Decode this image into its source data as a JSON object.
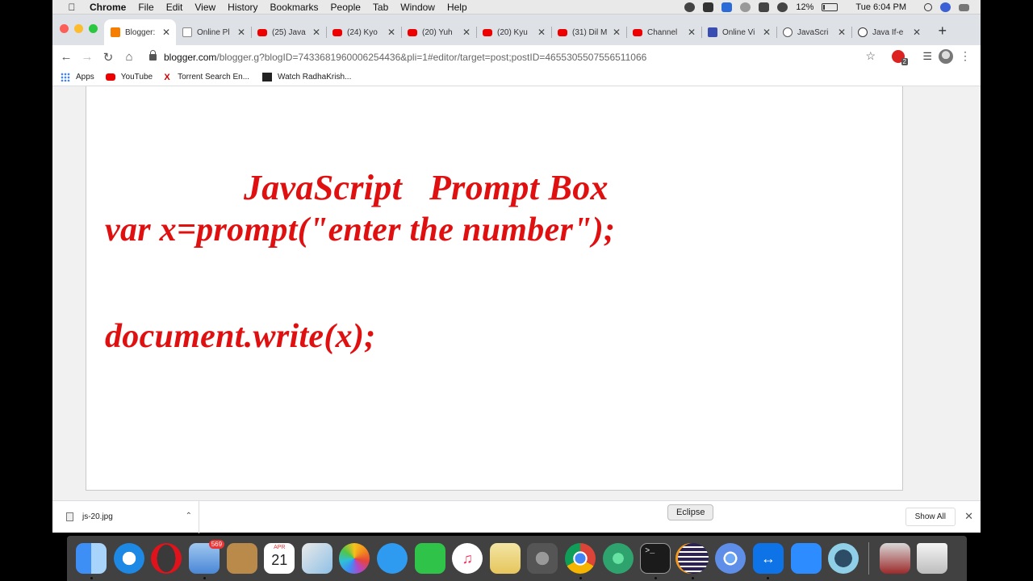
{
  "menubar": {
    "app_name": "Chrome",
    "items": [
      "File",
      "Edit",
      "View",
      "History",
      "Bookmarks",
      "People",
      "Tab",
      "Window",
      "Help"
    ],
    "battery": "12%",
    "battery_level": 0.12,
    "clock": "Tue 6:04 PM"
  },
  "browser": {
    "tabs": [
      {
        "title": "Blogger:",
        "favicon": "blogger-icon",
        "active": true
      },
      {
        "title": "Online Pl",
        "favicon": "page-icon"
      },
      {
        "title": "(25) Java",
        "favicon": "youtube-icon"
      },
      {
        "title": "(24) Kyo",
        "favicon": "youtube-icon"
      },
      {
        "title": "(20) Yuh",
        "favicon": "youtube-icon"
      },
      {
        "title": "(20) Kyu",
        "favicon": "youtube-icon"
      },
      {
        "title": "(31) Dil M",
        "favicon": "youtube-icon"
      },
      {
        "title": "Channel",
        "favicon": "youtube-icon"
      },
      {
        "title": "Online Vi",
        "favicon": "grid-icon"
      },
      {
        "title": "JavaScri",
        "favicon": "globe-icon"
      },
      {
        "title": "Java If-e",
        "favicon": "t-icon"
      }
    ],
    "url_host": "blogger.com",
    "url_path": "/blogger.g?blogID=7433681960006254436&pli=1#editor/target=post;postID=4655305507556511066",
    "extension_badge": "2",
    "bookmarks": [
      {
        "label": "Apps",
        "icon": "apps-icon"
      },
      {
        "label": "YouTube",
        "icon": "youtube-icon"
      },
      {
        "label": "Torrent Search En...",
        "icon": "x-icon"
      },
      {
        "label": "Watch RadhaKrish...",
        "icon": "radha-icon"
      }
    ]
  },
  "slide": {
    "title": "JavaScript   Prompt Box",
    "line1": "var x=prompt(\"enter the number\");",
    "line2": "document.write(x);"
  },
  "downloads": {
    "file": "js-20.jpg",
    "show_all": "Show All"
  },
  "tooltip": "Eclipse",
  "dock": {
    "mail_badge": "569",
    "calendar_month": "APR",
    "calendar_day": "21",
    "terminal_prompt": ">_"
  }
}
